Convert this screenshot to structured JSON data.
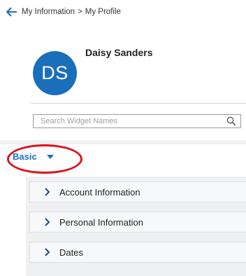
{
  "breadcrumb": {
    "back_icon": "arrow-left-icon",
    "items": [
      "My Information",
      "My Profile"
    ],
    "separator": ">"
  },
  "profile": {
    "initials": "DS",
    "name": "Daisy Sanders",
    "avatar_color": "#1a6fba"
  },
  "search": {
    "placeholder": "Search Widget Names",
    "value": "",
    "icon": "search-icon"
  },
  "view_selector": {
    "selected": "Basic",
    "icon": "caret-down-icon",
    "accent_color": "#1a6fba",
    "highlight_color": "#e0101a"
  },
  "sections": [
    {
      "label": "Account Information",
      "icon": "chevron-right-icon"
    },
    {
      "label": "Personal Information",
      "icon": "chevron-right-icon"
    },
    {
      "label": "Dates",
      "icon": "chevron-right-icon"
    }
  ]
}
